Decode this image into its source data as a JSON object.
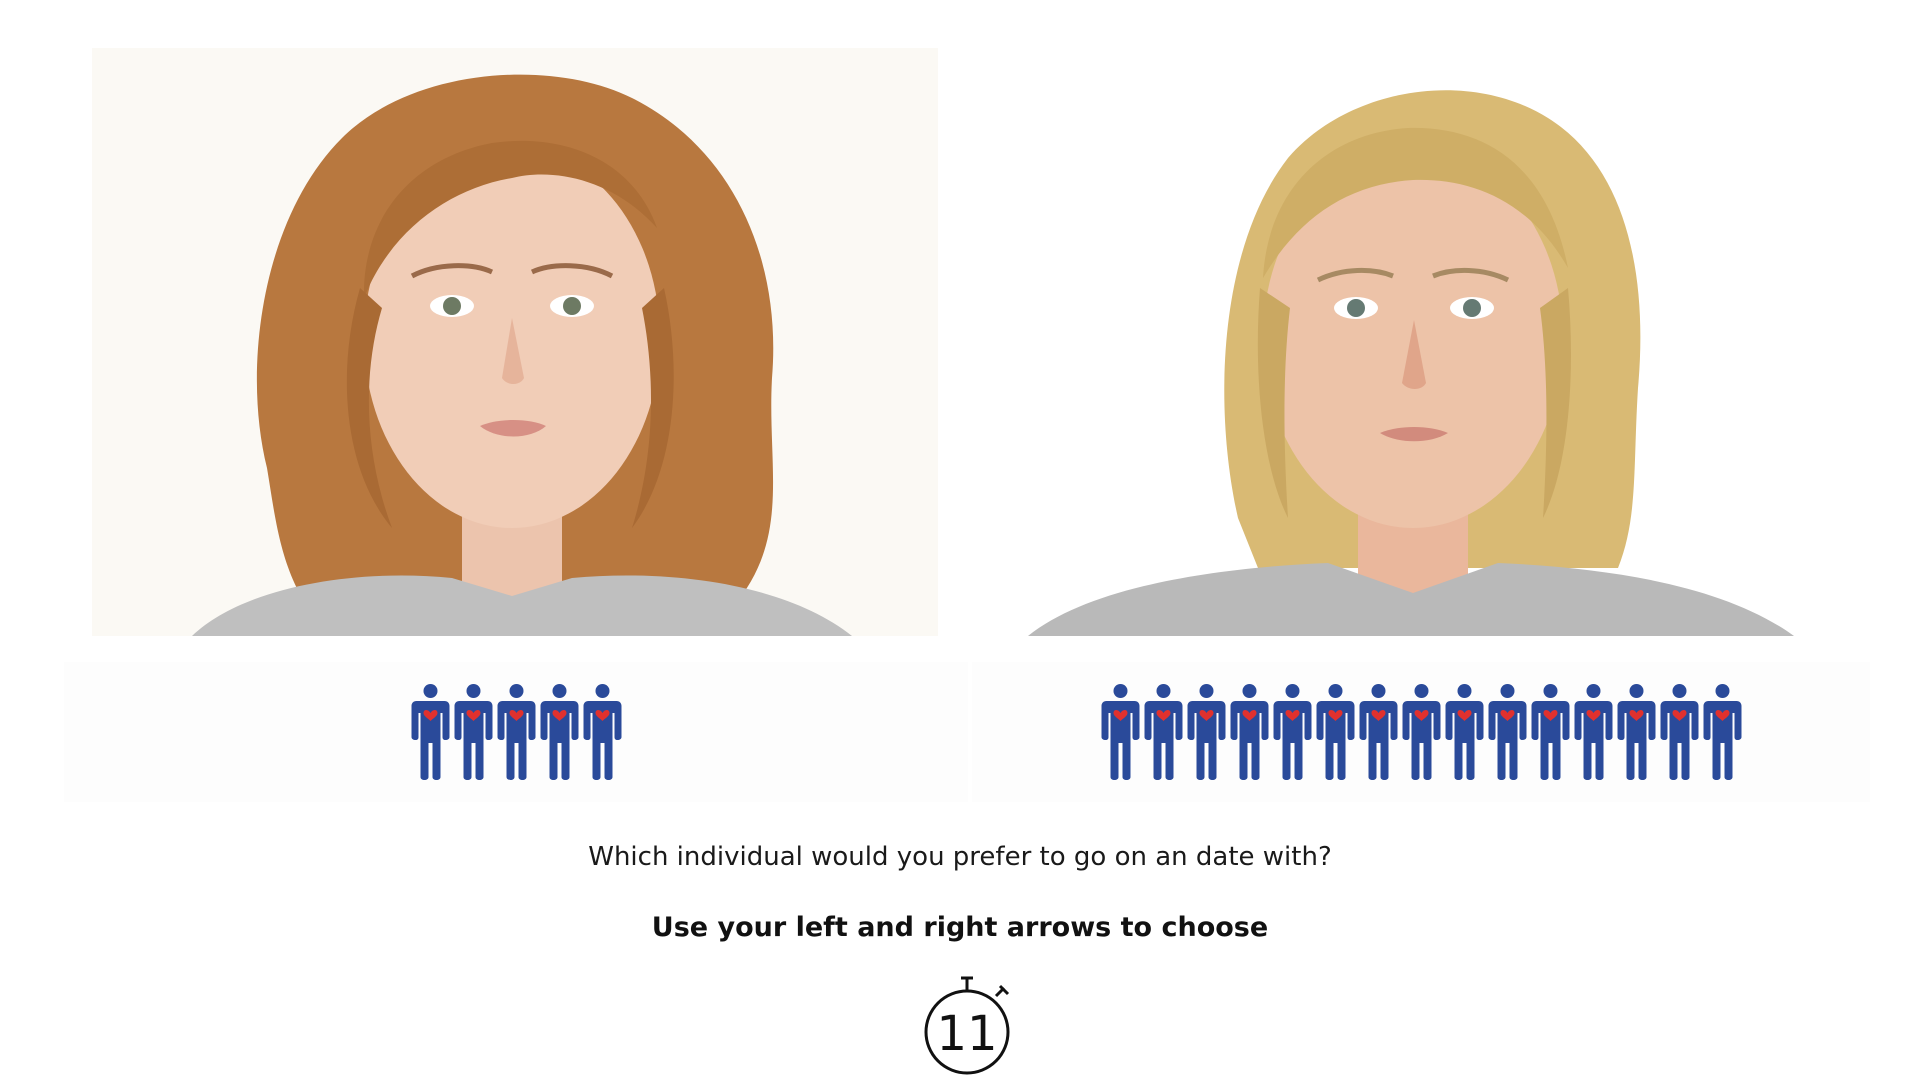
{
  "question": "Which individual would you prefer to go on an date with?",
  "instruction": "Use your left and right arrows to choose",
  "timer": {
    "value": "11",
    "icon": "stopwatch-icon"
  },
  "options": [
    {
      "position": "left",
      "hair_color": "#b9793f",
      "person_icon_count": 5
    },
    {
      "position": "right",
      "hair_color": "#d8b770",
      "person_icon_count": 15
    }
  ],
  "colors": {
    "person_icon": "#2a4a9a",
    "heart": "#e0312e",
    "sweater": "#bdbdbd"
  }
}
